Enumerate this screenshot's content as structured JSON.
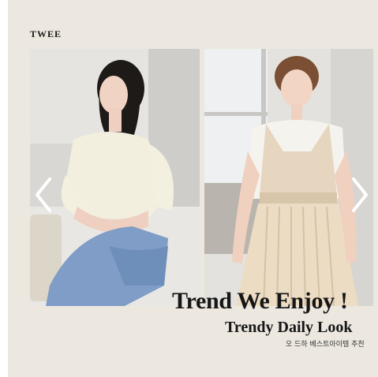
{
  "brand": {
    "name": "TWEE"
  },
  "carousel": {
    "prev_icon": "chevron-left-icon",
    "next_icon": "chevron-right-icon"
  },
  "banner": {
    "headline": "Trend We Enjoy !",
    "subhead": "Trendy Daily Look",
    "caption": "오 드하 베스트아이템 추천"
  },
  "colors": {
    "background": "#ece8df",
    "text": "#161616"
  }
}
